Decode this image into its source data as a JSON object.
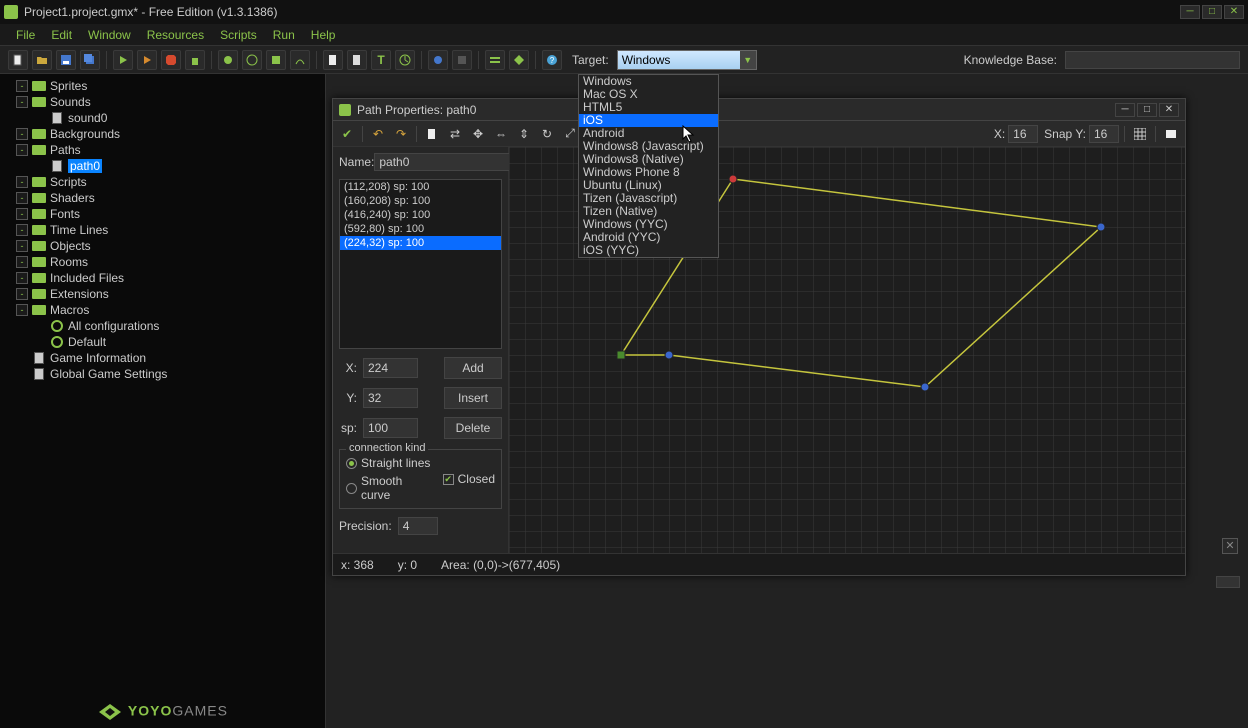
{
  "titlebar": {
    "title": "Project1.project.gmx*  -  Free Edition (v1.3.1386)"
  },
  "menubar": [
    "File",
    "Edit",
    "Window",
    "Resources",
    "Scripts",
    "Run",
    "Help"
  ],
  "toolbar": {
    "target_label": "Target:",
    "target_value": "Windows",
    "kb_label": "Knowledge Base:",
    "kb_value": ""
  },
  "target_options": [
    "Windows",
    "Mac OS X",
    "HTML5",
    "iOS",
    "Android",
    "Windows8 (Javascript)",
    "Windows8 (Native)",
    "Windows Phone 8",
    "Ubuntu (Linux)",
    "Tizen (Javascript)",
    "Tizen (Native)",
    "Windows (YYC)",
    "Android (YYC)",
    "iOS (YYC)"
  ],
  "tree": [
    {
      "indent": 0,
      "expander": "-",
      "icon": "folder",
      "label": "Sprites",
      "sel": false
    },
    {
      "indent": 0,
      "expander": "-",
      "icon": "folder",
      "label": "Sounds",
      "sel": false
    },
    {
      "indent": 1,
      "expander": "",
      "icon": "file",
      "label": "sound0",
      "sel": false
    },
    {
      "indent": 0,
      "expander": "-",
      "icon": "folder",
      "label": "Backgrounds",
      "sel": false
    },
    {
      "indent": 0,
      "expander": "-",
      "icon": "folder",
      "label": "Paths",
      "sel": false
    },
    {
      "indent": 1,
      "expander": "",
      "icon": "file",
      "label": "path0",
      "sel": true
    },
    {
      "indent": 0,
      "expander": "-",
      "icon": "folder",
      "label": "Scripts",
      "sel": false
    },
    {
      "indent": 0,
      "expander": "-",
      "icon": "folder",
      "label": "Shaders",
      "sel": false
    },
    {
      "indent": 0,
      "expander": "-",
      "icon": "folder",
      "label": "Fonts",
      "sel": false
    },
    {
      "indent": 0,
      "expander": "-",
      "icon": "folder",
      "label": "Time Lines",
      "sel": false
    },
    {
      "indent": 0,
      "expander": "-",
      "icon": "folder",
      "label": "Objects",
      "sel": false
    },
    {
      "indent": 0,
      "expander": "-",
      "icon": "folder",
      "label": "Rooms",
      "sel": false
    },
    {
      "indent": 0,
      "expander": "-",
      "icon": "folder",
      "label": "Included Files",
      "sel": false
    },
    {
      "indent": 0,
      "expander": "-",
      "icon": "folder",
      "label": "Extensions",
      "sel": false
    },
    {
      "indent": 0,
      "expander": "-",
      "icon": "folder",
      "label": "Macros",
      "sel": false
    },
    {
      "indent": 1,
      "expander": "",
      "icon": "c",
      "label": "All configurations",
      "sel": false
    },
    {
      "indent": 1,
      "expander": "",
      "icon": "c",
      "label": "Default",
      "sel": false
    },
    {
      "indent": 0,
      "expander": "",
      "icon": "file",
      "label": "Game Information",
      "sel": false
    },
    {
      "indent": 0,
      "expander": "",
      "icon": "file",
      "label": "Global Game Settings",
      "sel": false
    }
  ],
  "path_window": {
    "title": "Path Properties: path0",
    "snap_x_label": "X:",
    "snap_x": "16",
    "snap_y_label": "Snap Y:",
    "snap_y": "16",
    "name_label": "Name:",
    "name": "path0",
    "points": [
      {
        "text": "(112,208)   sp: 100",
        "sel": false
      },
      {
        "text": "(160,208)   sp: 100",
        "sel": false
      },
      {
        "text": "(416,240)   sp: 100",
        "sel": false
      },
      {
        "text": "(592,80)    sp: 100",
        "sel": false
      },
      {
        "text": "(224,32)    sp: 100",
        "sel": true
      }
    ],
    "x_label": "X:",
    "x": "224",
    "y_label": "Y:",
    "y": "32",
    "sp_label": "sp:",
    "sp": "100",
    "btn_add": "Add",
    "btn_insert": "Insert",
    "btn_delete": "Delete",
    "conn_title": "connection kind",
    "radio_straight": "Straight lines",
    "radio_smooth": "Smooth curve",
    "check_closed": "Closed",
    "precision_label": "Precision:",
    "precision": "4",
    "status_x": "x: 368",
    "status_y": "y: 0",
    "status_area": "Area: (0,0)->(677,405)"
  },
  "yoyo": "YOYOGAMES"
}
